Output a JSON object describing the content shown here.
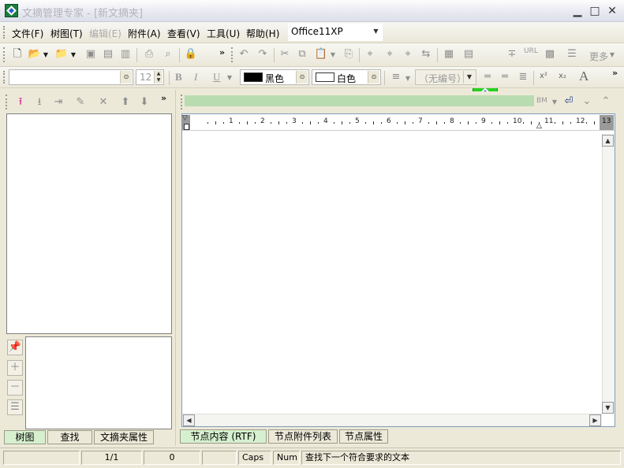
{
  "window": {
    "title": "文摘管理专家 - [新文摘夹]",
    "minimize_glyph": "▁",
    "maximize_glyph": "□",
    "close_glyph": "✕"
  },
  "menu": {
    "items": [
      "文件(F)",
      "树图(T)",
      "编辑(E)",
      "附件(A)",
      "查看(V)",
      "工具(U)",
      "帮助(H)"
    ],
    "theme_combo": "Office11XP"
  },
  "toolbar": {
    "more_label": "更多",
    "bm_label": "BM",
    "url_label": "URL"
  },
  "format_bar": {
    "font_size": "12",
    "bold": "B",
    "italic": "I",
    "underline": "U",
    "fore_color_name": "黑色",
    "fore_color": "#000000",
    "back_color_name": "白色",
    "back_color": "#ffffff",
    "numbering": "（无编号）",
    "superscript": "x²",
    "subscript": "x₂",
    "font_big": "A"
  },
  "left_tabs": [
    "树图",
    "查找",
    "文摘夹属性"
  ],
  "right_tabs": [
    "节点内容 (RTF)",
    "节点附件列表",
    "节点属性"
  ],
  "ruler": {
    "numbers": [
      "1",
      "2",
      "3",
      "4",
      "5",
      "6",
      "7",
      "8",
      "9",
      "10",
      "11",
      "12",
      "13"
    ]
  },
  "status": {
    "page": "1/1",
    "count": "0",
    "caps": "Caps",
    "num": "Num",
    "message": "查找下一个符合要求的文本"
  },
  "colors": {
    "accent_green": "#27d21f",
    "progress_green": "#b8dcb0",
    "tab_active": "#d6f0cf"
  }
}
